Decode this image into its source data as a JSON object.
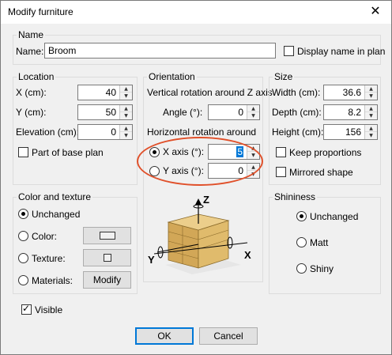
{
  "window": {
    "title": "Modify furniture",
    "close_glyph": "✕"
  },
  "name_group": {
    "legend": "Name",
    "name_label": "Name:",
    "name_value": "Broom",
    "display_name_label": "Display name in plan"
  },
  "location": {
    "legend": "Location",
    "x_label": "X (cm):",
    "x_value": "40",
    "y_label": "Y (cm):",
    "y_value": "50",
    "elevation_label": "Elevation (cm):",
    "elevation_value": "0",
    "base_plan_label": "Part of base plan"
  },
  "orientation": {
    "legend": "Orientation",
    "vertical_caption": "Vertical rotation around Z axis",
    "angle_label": "Angle (°):",
    "angle_value": "0",
    "horizontal_caption": "Horizontal rotation around",
    "x_axis_label": "X axis (°):",
    "x_axis_value": "5",
    "y_axis_label": "Y axis (°):",
    "y_axis_value": "0",
    "axis_z": "Z",
    "axis_x": "X",
    "axis_y": "Y"
  },
  "size": {
    "legend": "Size",
    "width_label": "Width (cm):",
    "width_value": "36.6",
    "depth_label": "Depth (cm):",
    "depth_value": "8.2",
    "height_label": "Height (cm):",
    "height_value": "156",
    "keep_proportions_label": "Keep proportions",
    "mirrored_label": "Mirrored shape"
  },
  "color_texture": {
    "legend": "Color and texture",
    "unchanged": "Unchanged",
    "color": "Color:",
    "texture": "Texture:",
    "materials": "Materials:",
    "modify": "Modify"
  },
  "shininess": {
    "legend": "Shininess",
    "unchanged": "Unchanged",
    "matt": "Matt",
    "shiny": "Shiny"
  },
  "visible_label": "Visible",
  "buttons": {
    "ok": "OK",
    "cancel": "Cancel"
  },
  "colors": {
    "highlight": "#e0502a",
    "selection": "#0078d7",
    "furniture": "#d9b468"
  }
}
